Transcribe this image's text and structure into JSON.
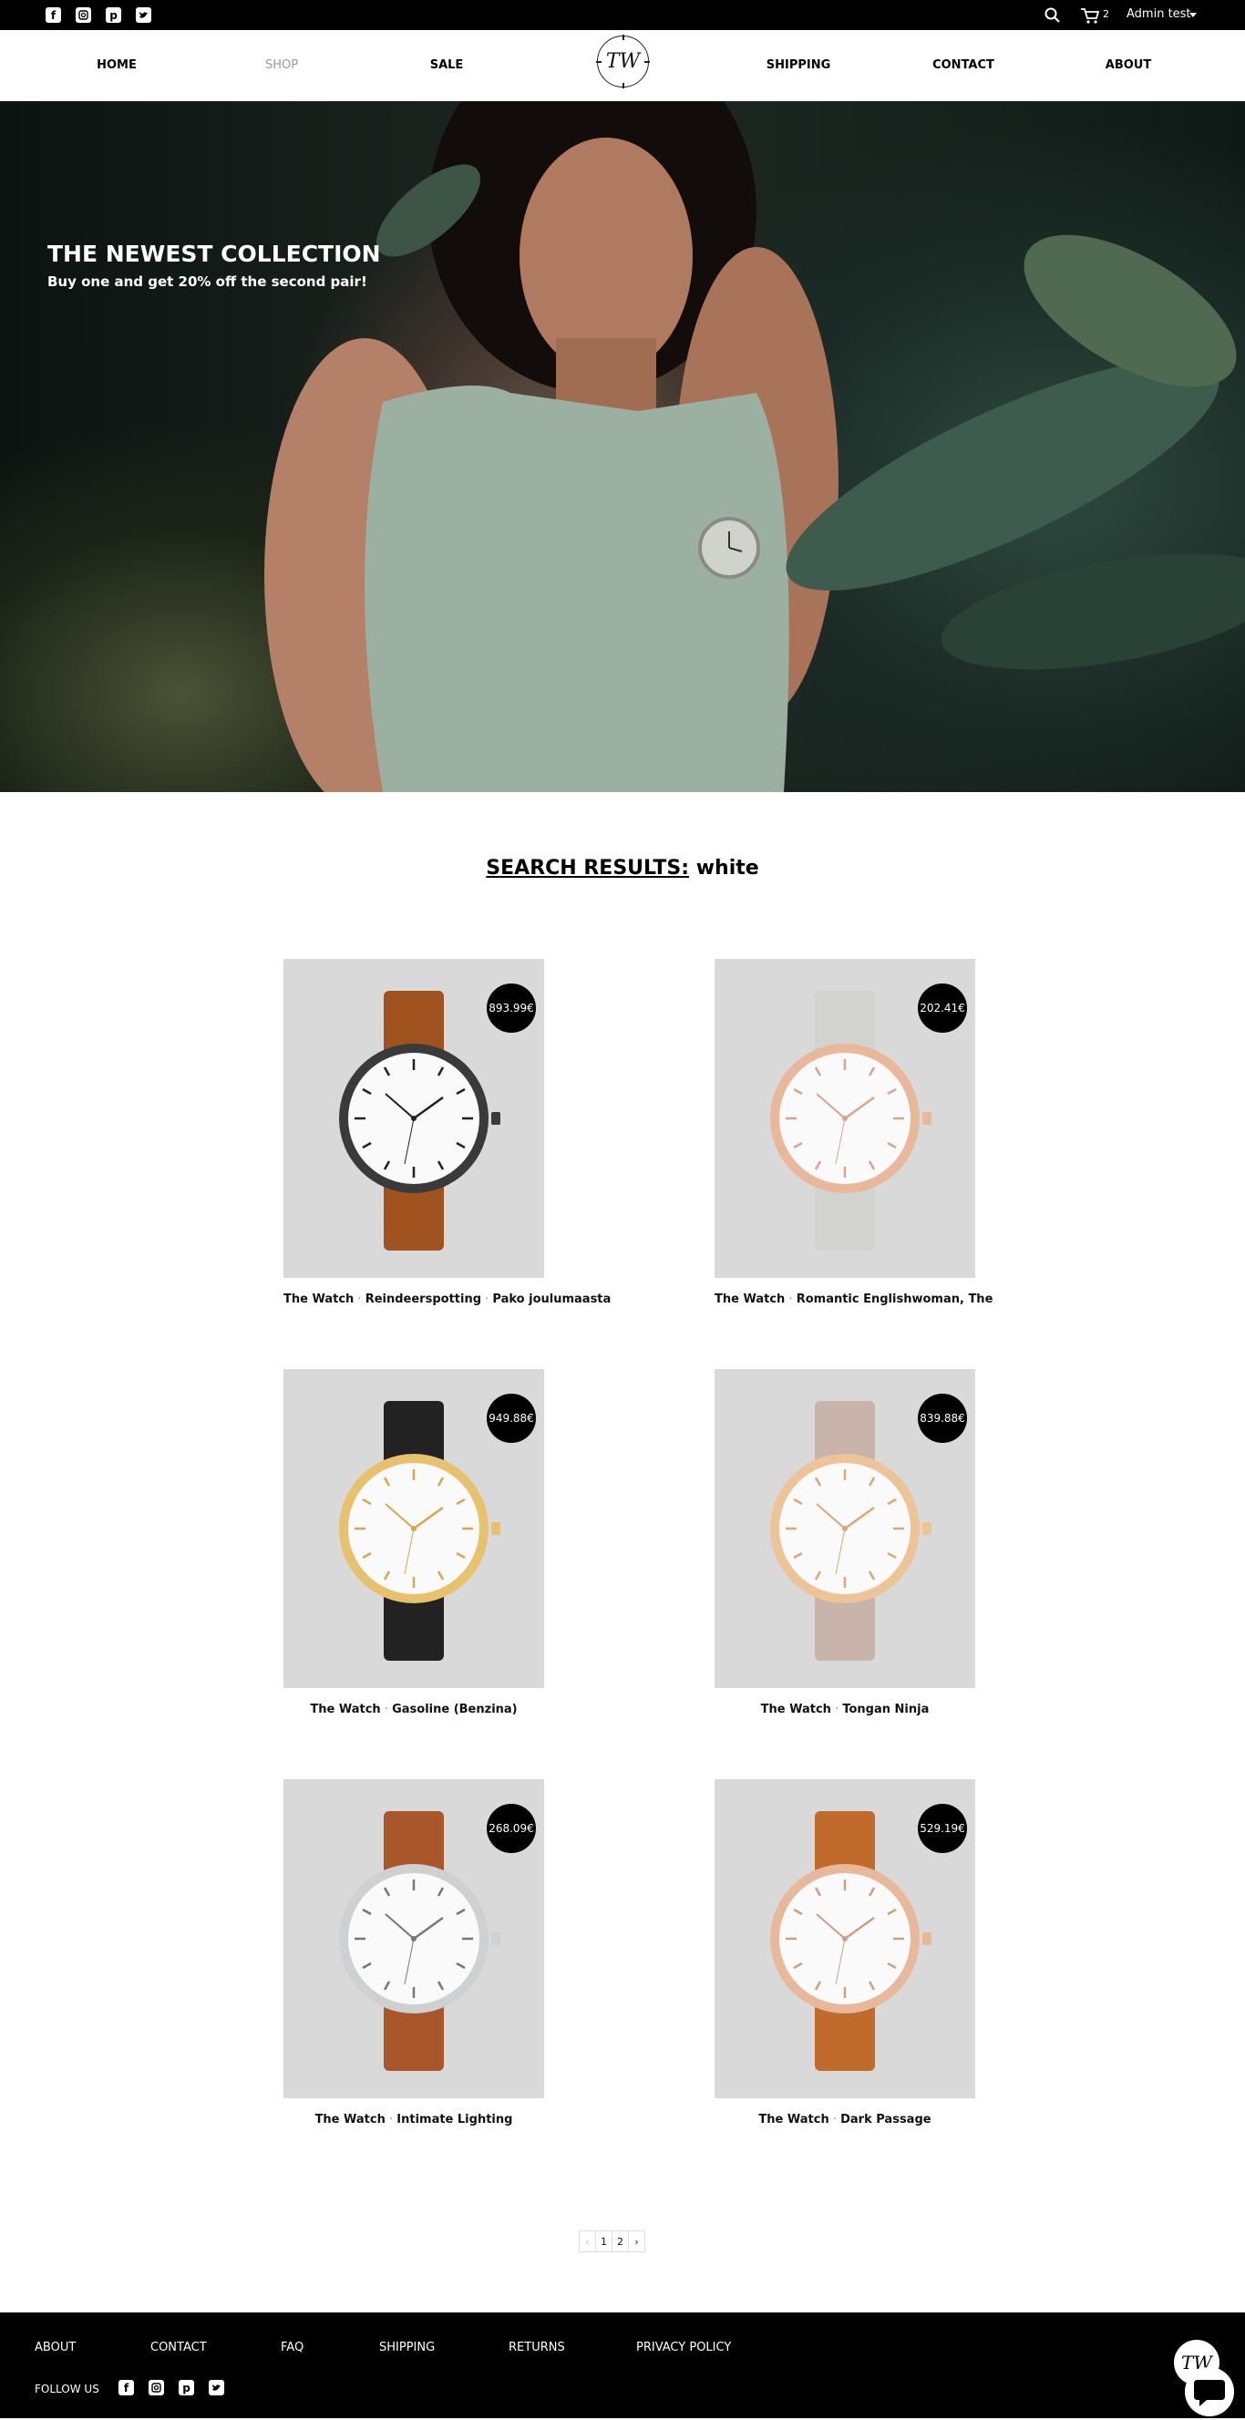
{
  "topbar": {
    "social_icons": [
      "facebook-icon",
      "instagram-icon",
      "pinterest-icon",
      "twitter-icon"
    ],
    "cart_count": "2",
    "user_name": "Admin test"
  },
  "nav": {
    "items": [
      "HOME",
      "SHOP",
      "SALE",
      "SHIPPING",
      "CONTACT",
      "ABOUT"
    ],
    "active": "SHOP",
    "logo_text": "TW"
  },
  "hero": {
    "title": "THE NEWEST COLLECTION",
    "subtitle": "Buy one and get 20% off the second pair!"
  },
  "search": {
    "label": "SEARCH RESULTS:",
    "query": "white"
  },
  "products": [
    {
      "brand": "The Watch",
      "name": "Reindeerspotting",
      "extra": "Pako joulumaasta",
      "price": "893.99€",
      "strap": "#a0521f",
      "case": "#3a3a3a",
      "accent": "#222"
    },
    {
      "brand": "The Watch",
      "name": "Romantic Englishwoman, The",
      "extra": "",
      "price": "202.41€",
      "strap": "#d2d2cf",
      "case": "#e9b79a",
      "accent": "#d9a58a"
    },
    {
      "brand": "The Watch",
      "name": "Gasoline (Benzina)",
      "extra": "",
      "price": "949.88€",
      "strap": "#222222",
      "case": "#e7c16e",
      "accent": "#d4a84e"
    },
    {
      "brand": "The Watch",
      "name": "Tongan Ninja",
      "extra": "",
      "price": "839.88€",
      "strap": "#c9b4ac",
      "case": "#ecc498",
      "accent": "#d9a878"
    },
    {
      "brand": "The Watch",
      "name": "Intimate Lighting",
      "extra": "",
      "price": "268.09€",
      "strap": "#a8562a",
      "case": "#cfd0d2",
      "accent": "#777"
    },
    {
      "brand": "The Watch",
      "name": "Dark Passage",
      "extra": "",
      "price": "529.19€",
      "strap": "#c06a2c",
      "case": "#e8b89a",
      "accent": "#caa080"
    }
  ],
  "pagination": {
    "prev": "‹",
    "pages": [
      "1",
      "2"
    ],
    "next": "›"
  },
  "footer": {
    "links": [
      "ABOUT",
      "CONTACT",
      "FAQ",
      "SHIPPING",
      "RETURNS",
      "PRIVACY POLICY"
    ],
    "follow_label": "FOLLOW US",
    "social_icons": [
      "facebook-icon",
      "instagram-icon",
      "pinterest-icon",
      "twitter-icon"
    ],
    "logo_text": "TW"
  },
  "colors": {
    "bar": "#000000",
    "card_bg": "#d9d9d9",
    "price_bg": "#000000",
    "active_nav": "#999999"
  }
}
